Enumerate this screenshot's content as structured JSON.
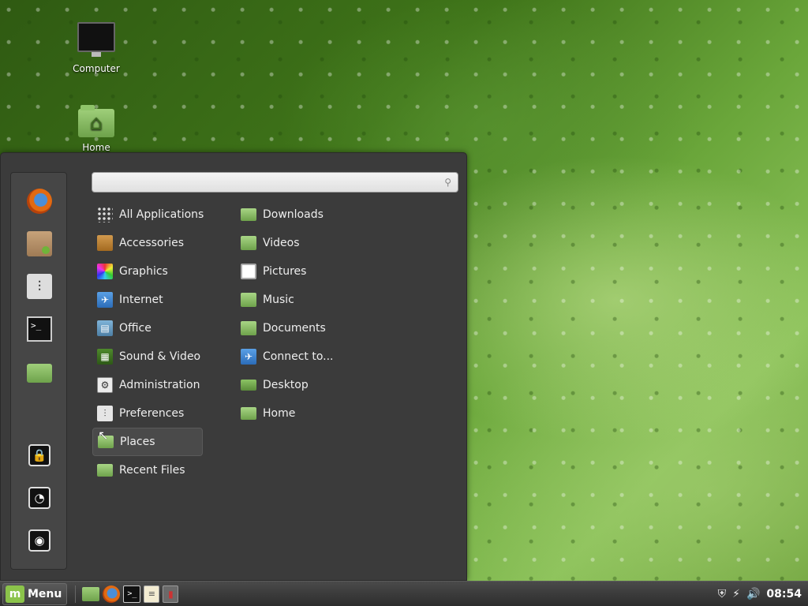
{
  "desktop": {
    "icons": [
      {
        "label": "Computer",
        "icon": "computer-icon"
      },
      {
        "label": "Home",
        "icon": "home-folder-icon"
      }
    ]
  },
  "menu": {
    "search": {
      "value": "",
      "placeholder": ""
    },
    "favorites": [
      {
        "icon": "firefox-icon"
      },
      {
        "icon": "package-manager-icon"
      },
      {
        "icon": "system-settings-icon"
      },
      {
        "icon": "terminal-icon"
      },
      {
        "icon": "files-icon"
      },
      {
        "icon": "lock-screen-icon"
      },
      {
        "icon": "logout-icon"
      },
      {
        "icon": "shutdown-icon"
      }
    ],
    "categories": [
      {
        "label": "All Applications",
        "icon": "grid-icon"
      },
      {
        "label": "Accessories",
        "icon": "accessories-icon"
      },
      {
        "label": "Graphics",
        "icon": "graphics-icon"
      },
      {
        "label": "Internet",
        "icon": "internet-icon"
      },
      {
        "label": "Office",
        "icon": "office-icon"
      },
      {
        "label": "Sound & Video",
        "icon": "sound-video-icon"
      },
      {
        "label": "Administration",
        "icon": "administration-icon"
      },
      {
        "label": "Preferences",
        "icon": "preferences-icon"
      },
      {
        "label": "Places",
        "icon": "places-folder-icon",
        "selected": true
      },
      {
        "label": "Recent Files",
        "icon": "recent-files-icon"
      }
    ],
    "places": [
      {
        "label": "Downloads",
        "icon": "downloads-folder-icon"
      },
      {
        "label": "Videos",
        "icon": "videos-folder-icon"
      },
      {
        "label": "Pictures",
        "icon": "pictures-folder-icon"
      },
      {
        "label": "Music",
        "icon": "music-folder-icon"
      },
      {
        "label": "Documents",
        "icon": "documents-folder-icon"
      },
      {
        "label": "Connect to...",
        "icon": "network-icon"
      },
      {
        "label": "Desktop",
        "icon": "desktop-folder-icon"
      },
      {
        "label": "Home",
        "icon": "home-folder-icon"
      }
    ]
  },
  "taskbar": {
    "menu_label": "Menu",
    "menu_logo": "m",
    "launchers": [
      {
        "icon": "files-icon"
      },
      {
        "icon": "firefox-icon"
      },
      {
        "icon": "terminal-icon"
      },
      {
        "icon": "text-editor-icon"
      },
      {
        "icon": "window-task-icon"
      }
    ],
    "clock": "08:54"
  },
  "colors": {
    "panel_bg": "#3b3b3b",
    "mint_green": "#8bc34a",
    "text": "#eeeeee"
  }
}
